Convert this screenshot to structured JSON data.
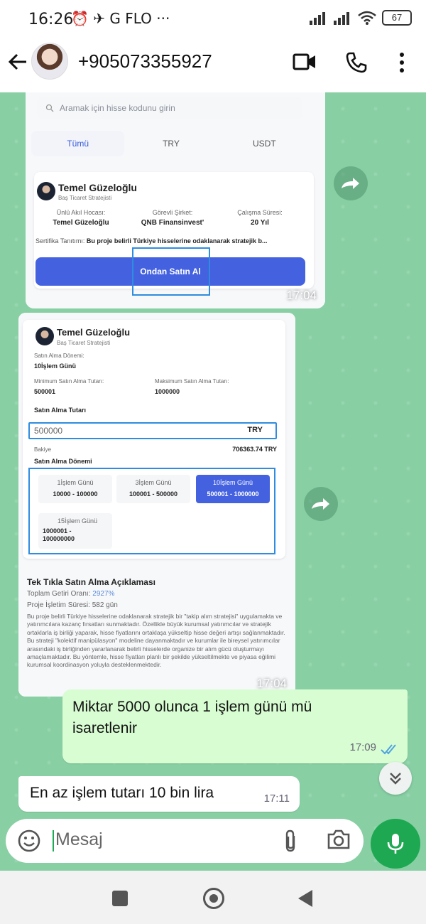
{
  "status_bar": {
    "time": "16:26",
    "left_icons": "⏰ ✈ G FLO ···",
    "battery": "67"
  },
  "header": {
    "contact": "+905073355927"
  },
  "image1": {
    "search_placeholder": "Aramak için hisse kodunu girin",
    "tabs": [
      "Tümü",
      "TRY",
      "USDT"
    ],
    "card": {
      "name": "Temel Güzeloğlu",
      "role": "Baş Ticaret Stratejisti",
      "columns": [
        {
          "label": "Ünlü Akıl Hocası:",
          "value": "Temel Güzeloğlu"
        },
        {
          "label": "Görevli Şirket:",
          "value": "QNB Finansinvest'"
        },
        {
          "label": "Çalışma Süresi:",
          "value": "20 Yıl"
        }
      ],
      "cert_label": "Sertifika Tanıtımı:",
      "cert_text": "Bu proje belirli Türkiye hisselerine odaklanarak stratejik b...",
      "buy_button": "Ondan Satın Al"
    },
    "time": "17:04"
  },
  "image2": {
    "name": "Temel Güzeloğlu",
    "role": "Baş Ticaret Stratejisti",
    "period_label": "Satın Alma Dönemi:",
    "period_value": "10İşlem Günü",
    "min_label": "Minimum Satın Alma Tutarı:",
    "min_value": "500001",
    "max_label": "Maksimum Satın Alma Tutarı:",
    "max_value": "1000000",
    "amount_label": "Satın Alma Tutarı",
    "amount_value": "500000",
    "currency": "TRY",
    "balance_label": "Bakiye",
    "balance_value": "706363.74 TRY",
    "periods_label": "Satın Alma Dönemi",
    "periods": [
      {
        "name": "1İşlem Günü",
        "range": "10000 - 100000"
      },
      {
        "name": "3İşlem Günü",
        "range": "100001 - 500000"
      },
      {
        "name": "10İşlem Günü",
        "range": "500001 - 1000000"
      },
      {
        "name": "15İşlem Günü",
        "range": "1000001 - 100000000"
      }
    ],
    "desc_title": "Tek Tıkla Satın Alma Açıklaması",
    "total_return_label": "Toplam Getiri Oranı:",
    "total_return_value": "2927%",
    "duration_label": "Proje İşletim Süresi:",
    "duration_value": "582 gün",
    "description": "Bu proje belirli Türkiye hisselerine odaklanarak stratejik bir \"takip alım stratejisi\" uygulamakta ve yatırımcılara kazanç fırsatları sunmaktadır. Özellikle büyük kurumsal yatırımcılar ve stratejik ortaklarla iş birliği yaparak, hisse fiyatlarını ortaklaşa yükseltip hisse değeri artışı sağlanmaktadır. Bu strateji \"kolektif manipülasyon\" modeline dayanmaktadır ve kurumlar ile bireysel yatırımcılar arasındaki iş birliğinden yararlanarak belirli hisselerde organize bir alım gücü oluşturmayı amaçlamaktadır. Bu yöntemle, hisse fiyatları planlı bir şekilde yükseltilmekte ve piyasa eğilimi kurumsal koordinasyon yoluyla desteklenmektedir.",
    "time": "17:04"
  },
  "messages": {
    "outgoing": {
      "text": "Miktar 5000 olunca 1 işlem günü mü isaretlenir",
      "time": "17:09"
    },
    "incoming": {
      "text": "En az işlem tutarı 10 bin lira",
      "time": "17:11"
    }
  },
  "composer": {
    "placeholder": "Mesaj"
  },
  "colors": {
    "chat_bg": "#88cfa4",
    "outgoing_bubble": "#d8fdd2",
    "accent_green": "#1da851",
    "button_blue": "#4461e0",
    "highlight_blue": "#2f8de0"
  }
}
